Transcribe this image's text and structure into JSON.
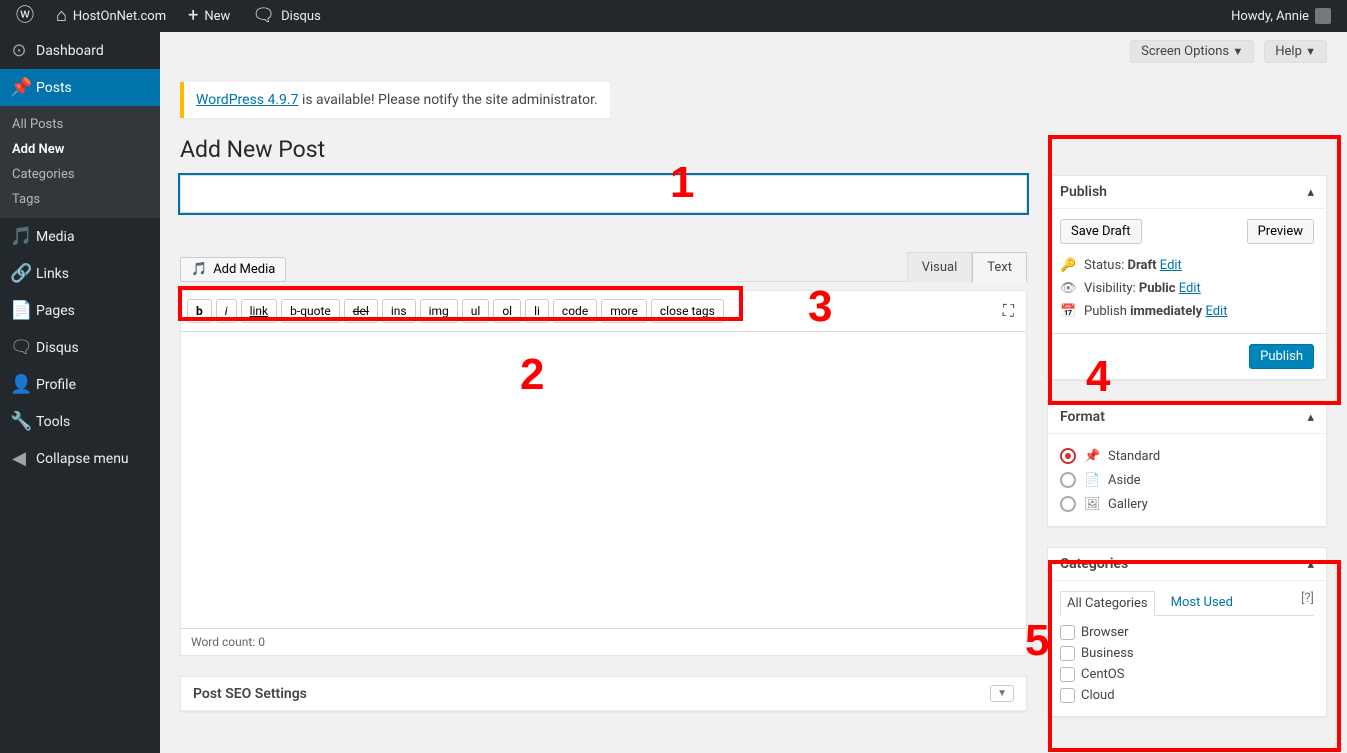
{
  "adminbar": {
    "site_name": "HostOnNet.com",
    "new_label": "New",
    "comments_label": "Disqus",
    "howdy": "Howdy, Annie"
  },
  "sidebar": {
    "dashboard": "Dashboard",
    "posts": "Posts",
    "posts_sub": {
      "all": "All Posts",
      "add": "Add New",
      "cats": "Categories",
      "tags": "Tags"
    },
    "media": "Media",
    "links": "Links",
    "pages": "Pages",
    "disqus": "Disqus",
    "profile": "Profile",
    "tools": "Tools",
    "collapse": "Collapse menu"
  },
  "top": {
    "screen_options": "Screen Options",
    "help": "Help"
  },
  "notice": {
    "link": "WordPress 4.9.7",
    "rest": " is available! Please notify the site administrator."
  },
  "page_title": "Add New Post",
  "title_placeholder": "",
  "add_media": "Add Media",
  "editor": {
    "tabs": {
      "visual": "Visual",
      "text": "Text"
    },
    "qt": {
      "b": "b",
      "i": "i",
      "link": "link",
      "bquote": "b-quote",
      "del": "del",
      "ins": "ins",
      "img": "img",
      "ul": "ul",
      "ol": "ol",
      "li": "li",
      "code": "code",
      "more": "more",
      "close": "close tags"
    },
    "wordcount_label": "Word count: ",
    "wordcount_value": "0"
  },
  "seo_title": "Post SEO Settings",
  "publish": {
    "title": "Publish",
    "save_draft": "Save Draft",
    "preview": "Preview",
    "status_label": "Status: ",
    "status_value": "Draft",
    "visibility_label": "Visibility: ",
    "visibility_value": "Public",
    "schedule_label": "Publish ",
    "schedule_value": "immediately",
    "edit": "Edit",
    "publish_btn": "Publish"
  },
  "format": {
    "title": "Format",
    "options": {
      "standard": "Standard",
      "aside": "Aside",
      "gallery": "Gallery"
    }
  },
  "categories": {
    "title": "Categories",
    "tab_all": "All Categories",
    "tab_most": "Most Used",
    "help": "[?]",
    "items": [
      "Browser",
      "Business",
      "CentOS",
      "Cloud"
    ]
  },
  "annotations": {
    "n1": "1",
    "n2": "2",
    "n3": "3",
    "n4": "4",
    "n5": "5"
  }
}
